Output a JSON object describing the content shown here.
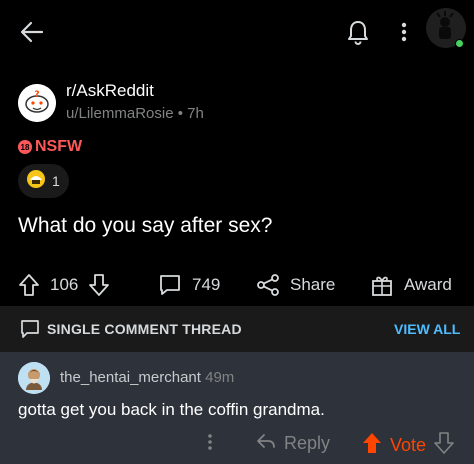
{
  "topbar": {
    "back_icon": "back-arrow-icon",
    "bell_icon": "bell-icon",
    "more_icon": "more-vertical-icon"
  },
  "post": {
    "subreddit": "r/AskReddit",
    "author": "u/LilemmaRosie",
    "separator": "•",
    "age": "7h",
    "nsfw_badge": "18",
    "nsfw_label": "NSFW",
    "award_count": "1",
    "title": "What do you say after sex?",
    "upvotes": "106",
    "comments": "749",
    "share_label": "Share",
    "award_label": "Award"
  },
  "thread": {
    "label": "SINGLE COMMENT THREAD",
    "view_all": "VIEW ALL"
  },
  "comment": {
    "username": "the_hentai_merchant",
    "age": "49m",
    "body": "gotta get you back in the coffin grandma.",
    "reply_label": "Reply",
    "vote_label": "Vote"
  },
  "colors": {
    "background": "#000000",
    "thread_bar": "#1a1a1b",
    "comment_bg": "#2d323b",
    "nsfw": "#ff585b",
    "link": "#4fbcff",
    "upvote_active": "#ff4500",
    "online": "#46d160"
  }
}
